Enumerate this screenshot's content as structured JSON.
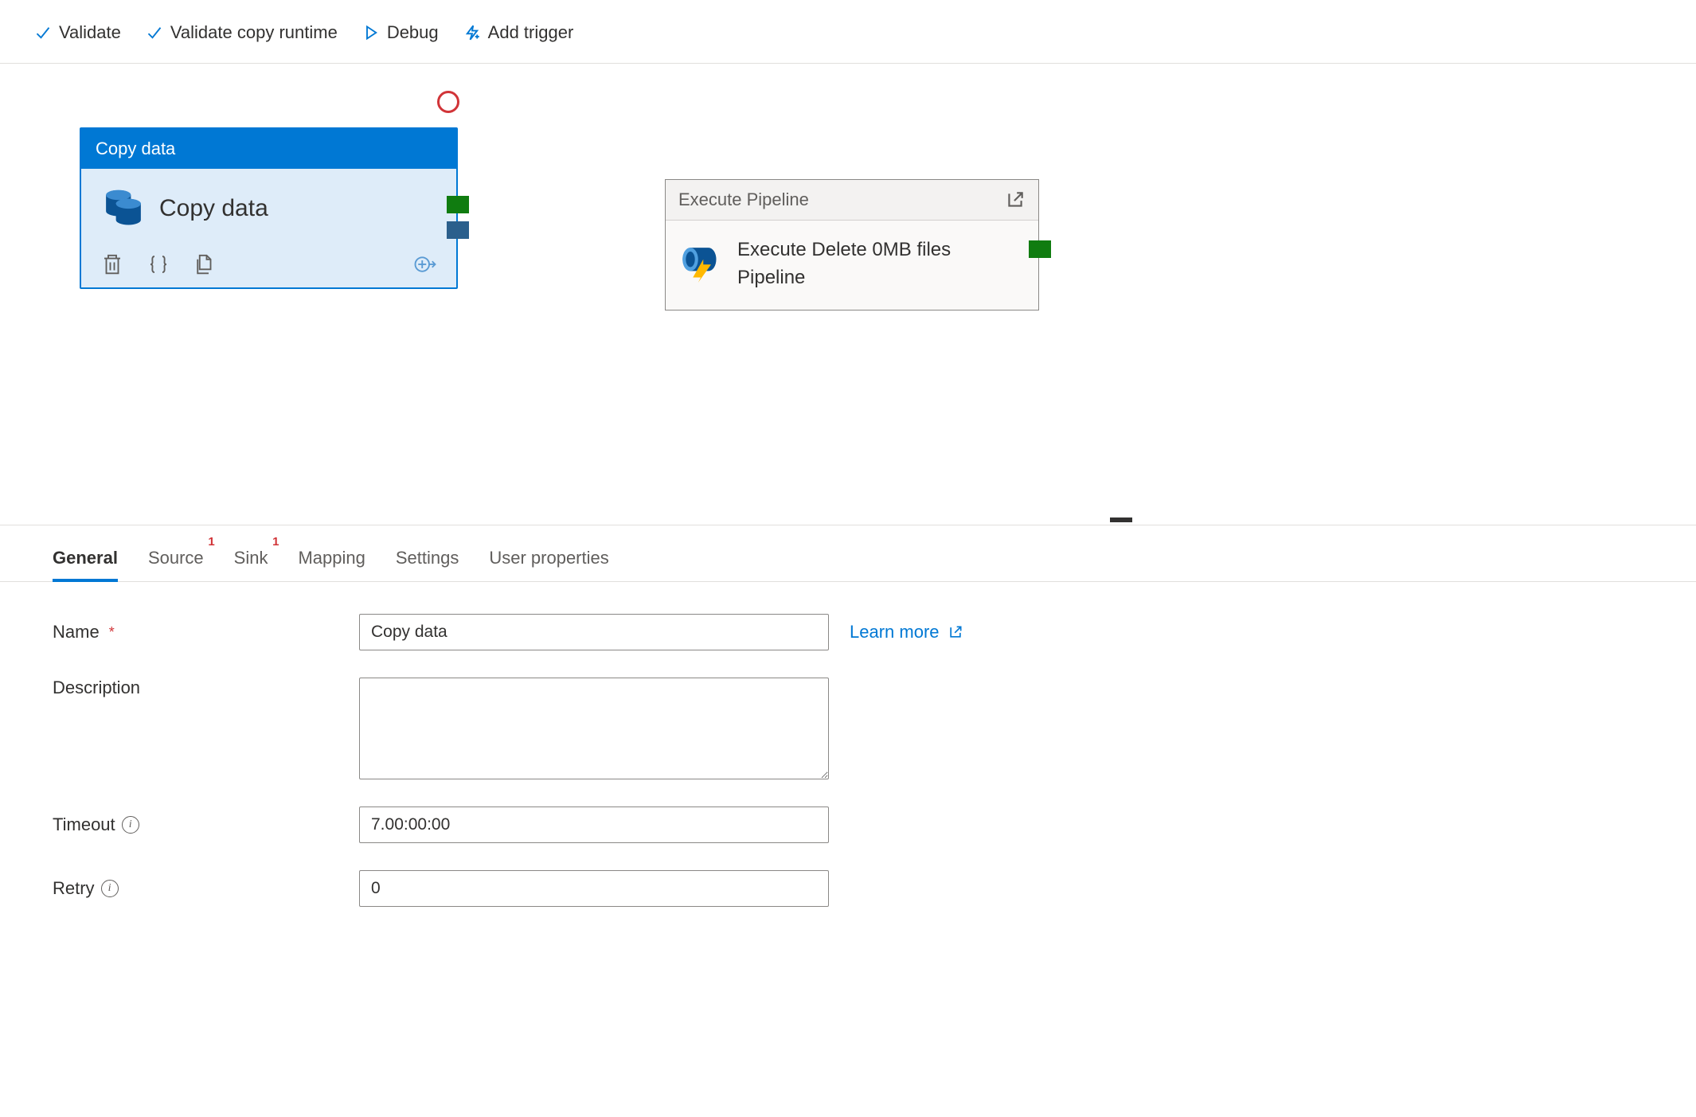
{
  "toolbar": {
    "validate": "Validate",
    "validate_copy_runtime": "Validate copy runtime",
    "debug": "Debug",
    "add_trigger": "Add trigger"
  },
  "nodes": {
    "copy": {
      "header": "Copy data",
      "title": "Copy data"
    },
    "exec": {
      "header": "Execute Pipeline",
      "title": "Execute Delete 0MB files Pipeline"
    }
  },
  "tabs": {
    "general": "General",
    "source": "Source",
    "source_badge": "1",
    "sink": "Sink",
    "sink_badge": "1",
    "mapping": "Mapping",
    "settings": "Settings",
    "user_properties": "User properties"
  },
  "form": {
    "name_label": "Name",
    "name_value": "Copy data",
    "learn_more": "Learn more",
    "description_label": "Description",
    "description_value": "",
    "timeout_label": "Timeout",
    "timeout_value": "7.00:00:00",
    "retry_label": "Retry",
    "retry_value": "0"
  }
}
